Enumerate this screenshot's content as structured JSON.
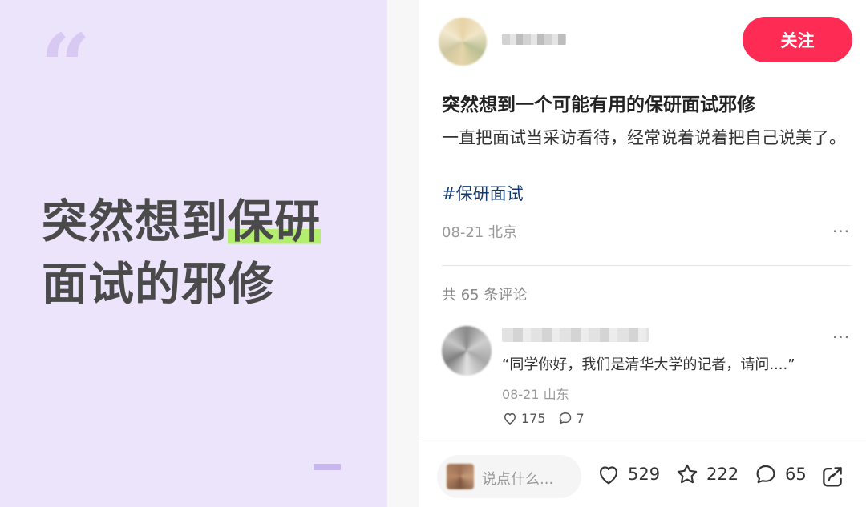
{
  "cover": {
    "line1_plain": "突然想到",
    "line1_highlight": "保研",
    "line2": "面试的邪修",
    "quote_glyph": "“",
    "highlight_color": "#b3ee6f",
    "background_color": "#ebe4fb"
  },
  "author": {
    "follow_label": "关注",
    "follow_color": "#fe2c55"
  },
  "post": {
    "title": "突然想到一个可能有用的保研面试邪修",
    "body": "一直把面试当采访看待，经常说着说着把自己说美了。",
    "tag": "#保研面试",
    "date": "08-21",
    "location": "北京",
    "more": "···"
  },
  "comments": {
    "count_label": "共 65 条评论",
    "items": [
      {
        "text": "“同学你好，我们是清华大学的记者，请问....”",
        "date": "08-21",
        "location": "山东",
        "likes": "175",
        "replies": "7",
        "more": "···"
      }
    ]
  },
  "bottom_bar": {
    "input_placeholder": "说点什么...",
    "likes": "529",
    "favorites": "222",
    "comments": "65"
  },
  "icons": [
    "heart-icon",
    "star-icon",
    "comment-icon",
    "share-icon",
    "more-icon",
    "quote-icon"
  ]
}
